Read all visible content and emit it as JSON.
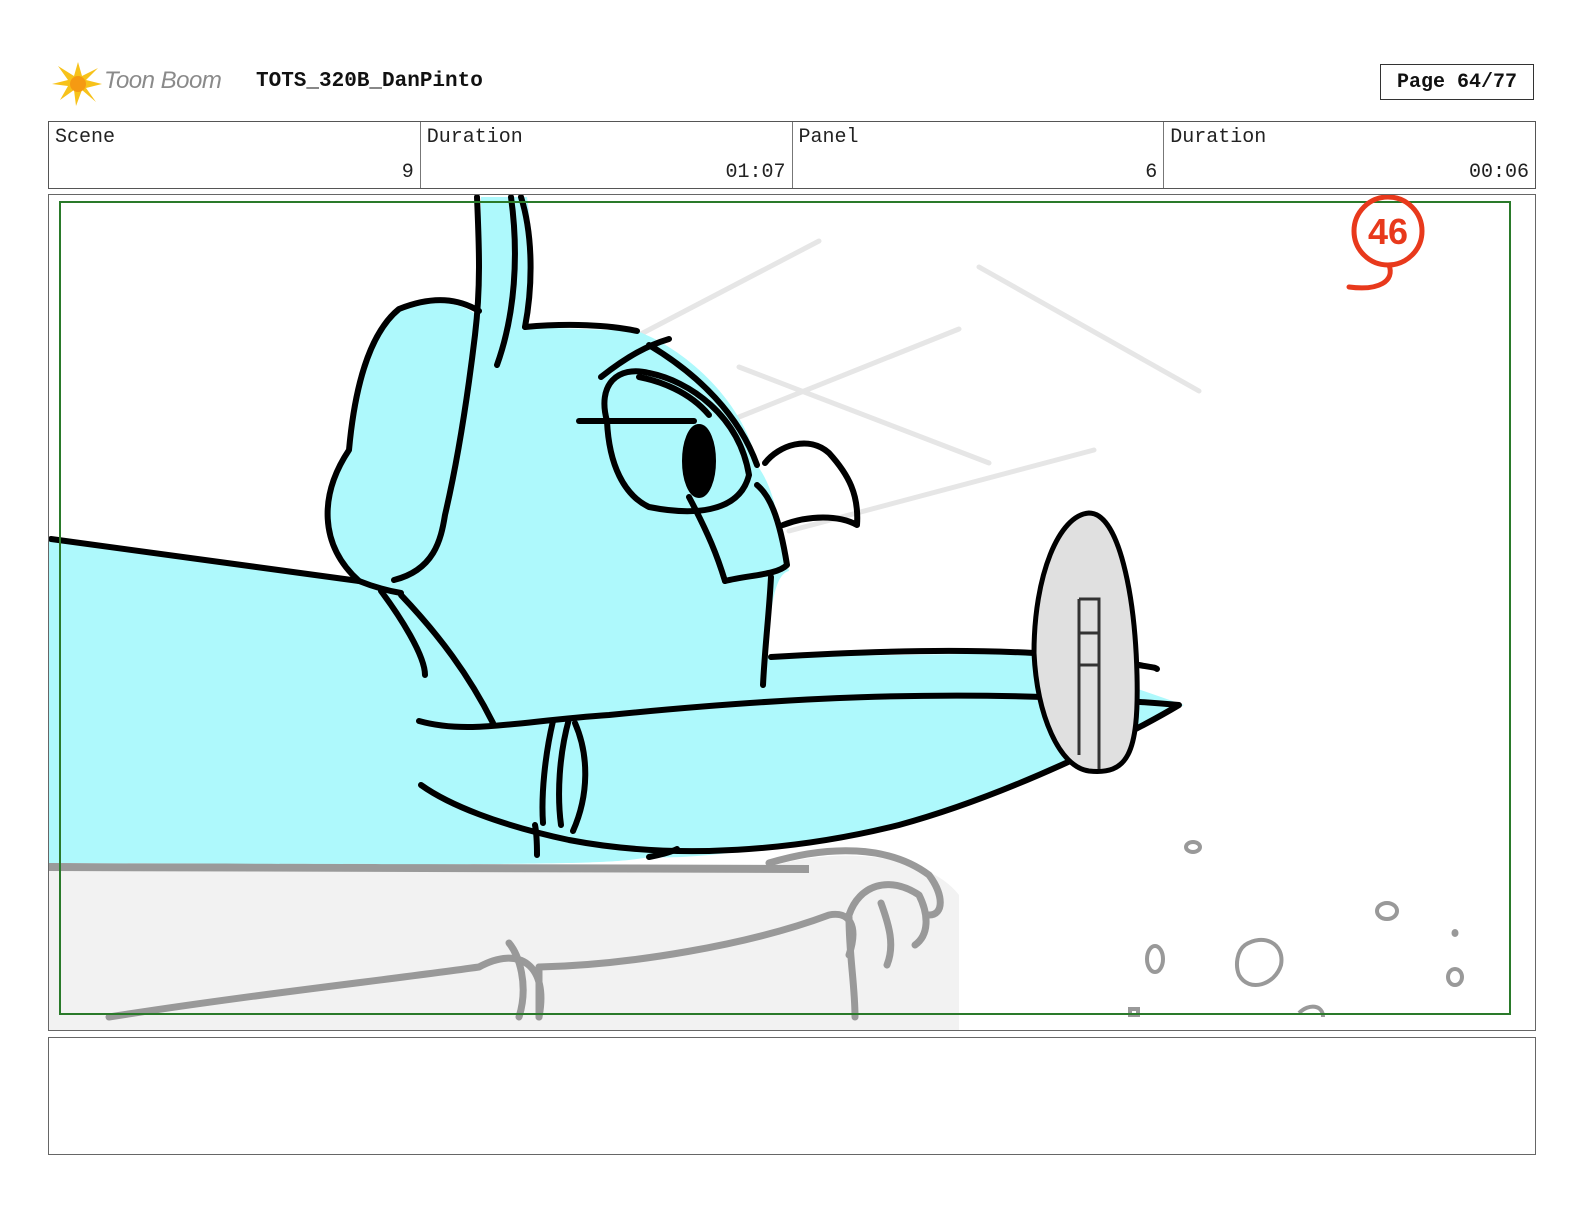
{
  "header": {
    "logo_text": "Toon Boom",
    "project_title": "TOTS_320B_DanPinto",
    "page_label": "Page 64/77"
  },
  "info": {
    "scene_label": "Scene",
    "scene_value": "9",
    "scene_duration_label": "Duration",
    "scene_duration_value": "01:07",
    "panel_label": "Panel",
    "panel_value": "6",
    "panel_duration_label": "Duration",
    "panel_duration_value": "00:06"
  },
  "panel": {
    "frame_number": "46",
    "colors": {
      "character_fill": "#aef9fc",
      "ink": "#000000",
      "safe_frame": "#2a7a2a",
      "annotation_red": "#e8391c",
      "background_gray": "#f2f2f2",
      "sketch_gray": "#999999"
    }
  },
  "notes": {
    "text": ""
  }
}
